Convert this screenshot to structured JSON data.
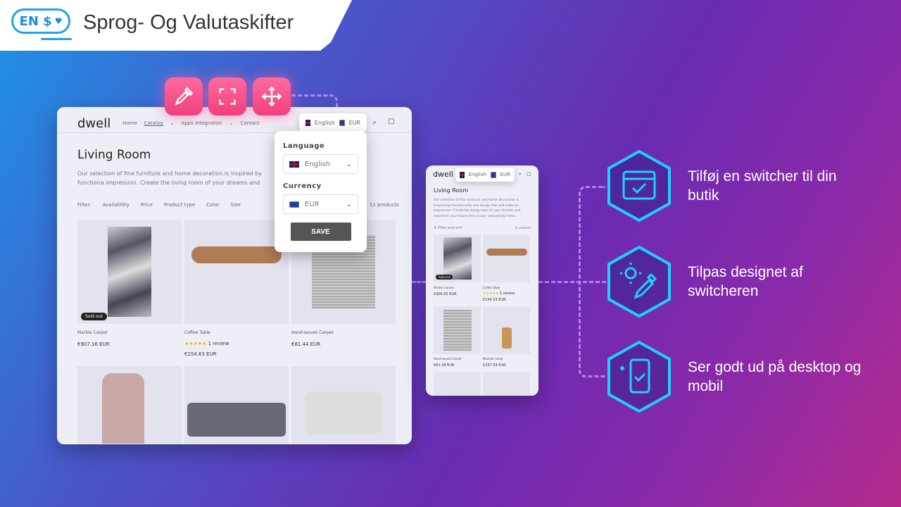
{
  "header": {
    "logo": "EN $",
    "title": "Sprog- Og Valutaskifter"
  },
  "store": {
    "brand": "dwell",
    "nav": [
      "Home",
      "Catalog",
      "Apps Integration",
      "Contact"
    ],
    "page_title": "Living Room",
    "description": "Our selection of fine furniture and home decoration is inspired by functionality and design that will make an impression. Create the living room of your dreams and transform your house into a cozy, welcoming home.",
    "description_desktop": "Our selection of fine furniture and home decoration is inspired by functiona impression. Create the living room of your dreams and transform your hous",
    "filter_label": "Filter:",
    "filters": [
      "Availability",
      "Price",
      "Product type",
      "Color",
      "Size"
    ],
    "product_count": "11 products",
    "filter_sort": "Filter and sort",
    "sold_out": "Sold out",
    "review": "1 review",
    "rating": 5,
    "products": [
      {
        "name": "Marble Carpet",
        "price": "€907.16 EUR"
      },
      {
        "name": "Coffee Table",
        "price": "€154.63 EUR"
      },
      {
        "name": "Hand-woven Carpet",
        "price": "€81.44 EUR"
      }
    ],
    "mobile_products": [
      {
        "name": "Marble Carpet",
        "price": "€906.55 EUR"
      },
      {
        "name": "Coffee Table",
        "price": "€154.53 EUR"
      },
      {
        "name": "Hand-woven Carpet",
        "price": "€81.38 EUR"
      },
      {
        "name": "Modular Lamp",
        "price": "€257.54 EUR"
      }
    ]
  },
  "switcher": {
    "language": "English",
    "currency": "EUR",
    "language_label": "Language",
    "currency_label": "Currency",
    "save": "SAVE"
  },
  "tools": [
    "eyedropper-icon",
    "crop-icon",
    "move-icon"
  ],
  "features": [
    {
      "icon": "browser-check-icon",
      "text": "Tilføj en switcher til din butik"
    },
    {
      "icon": "gear-eyedropper-icon",
      "text": "Tilpas designet af switcheren"
    },
    {
      "icon": "mobile-check-icon",
      "text": "Ser godt ud på desktop og mobil"
    }
  ],
  "colors": {
    "accent": "#1fd0ff",
    "tool": "#f0407a",
    "bg_start": "#1c94e6",
    "bg_end": "#b52b8c"
  }
}
